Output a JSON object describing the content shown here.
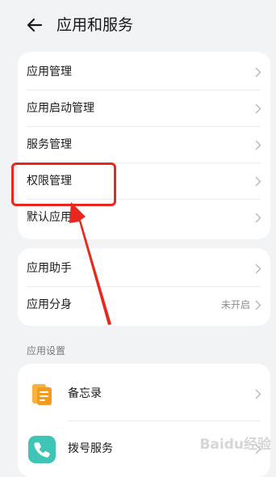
{
  "header": {
    "title": "应用和服务",
    "back_icon": "back-arrow-icon"
  },
  "groups": [
    {
      "items": [
        {
          "label": "应用管理"
        },
        {
          "label": "应用启动管理"
        },
        {
          "label": "服务管理"
        },
        {
          "label": "权限管理"
        },
        {
          "label": "默认应用"
        }
      ]
    },
    {
      "items": [
        {
          "label": "应用助手"
        },
        {
          "label": "应用分身",
          "value": "未开启"
        }
      ]
    }
  ],
  "section": {
    "title": "应用设置"
  },
  "app_settings": [
    {
      "label": "备忘录",
      "icon": "memo-app-icon",
      "icon_color": "#f5a623"
    },
    {
      "label": "拨号服务",
      "icon": "phone-app-icon",
      "icon_color": "#3ec5b5"
    }
  ],
  "annotation": {
    "color": "#e9271c"
  },
  "watermark": {
    "text": "Baidu经验"
  }
}
